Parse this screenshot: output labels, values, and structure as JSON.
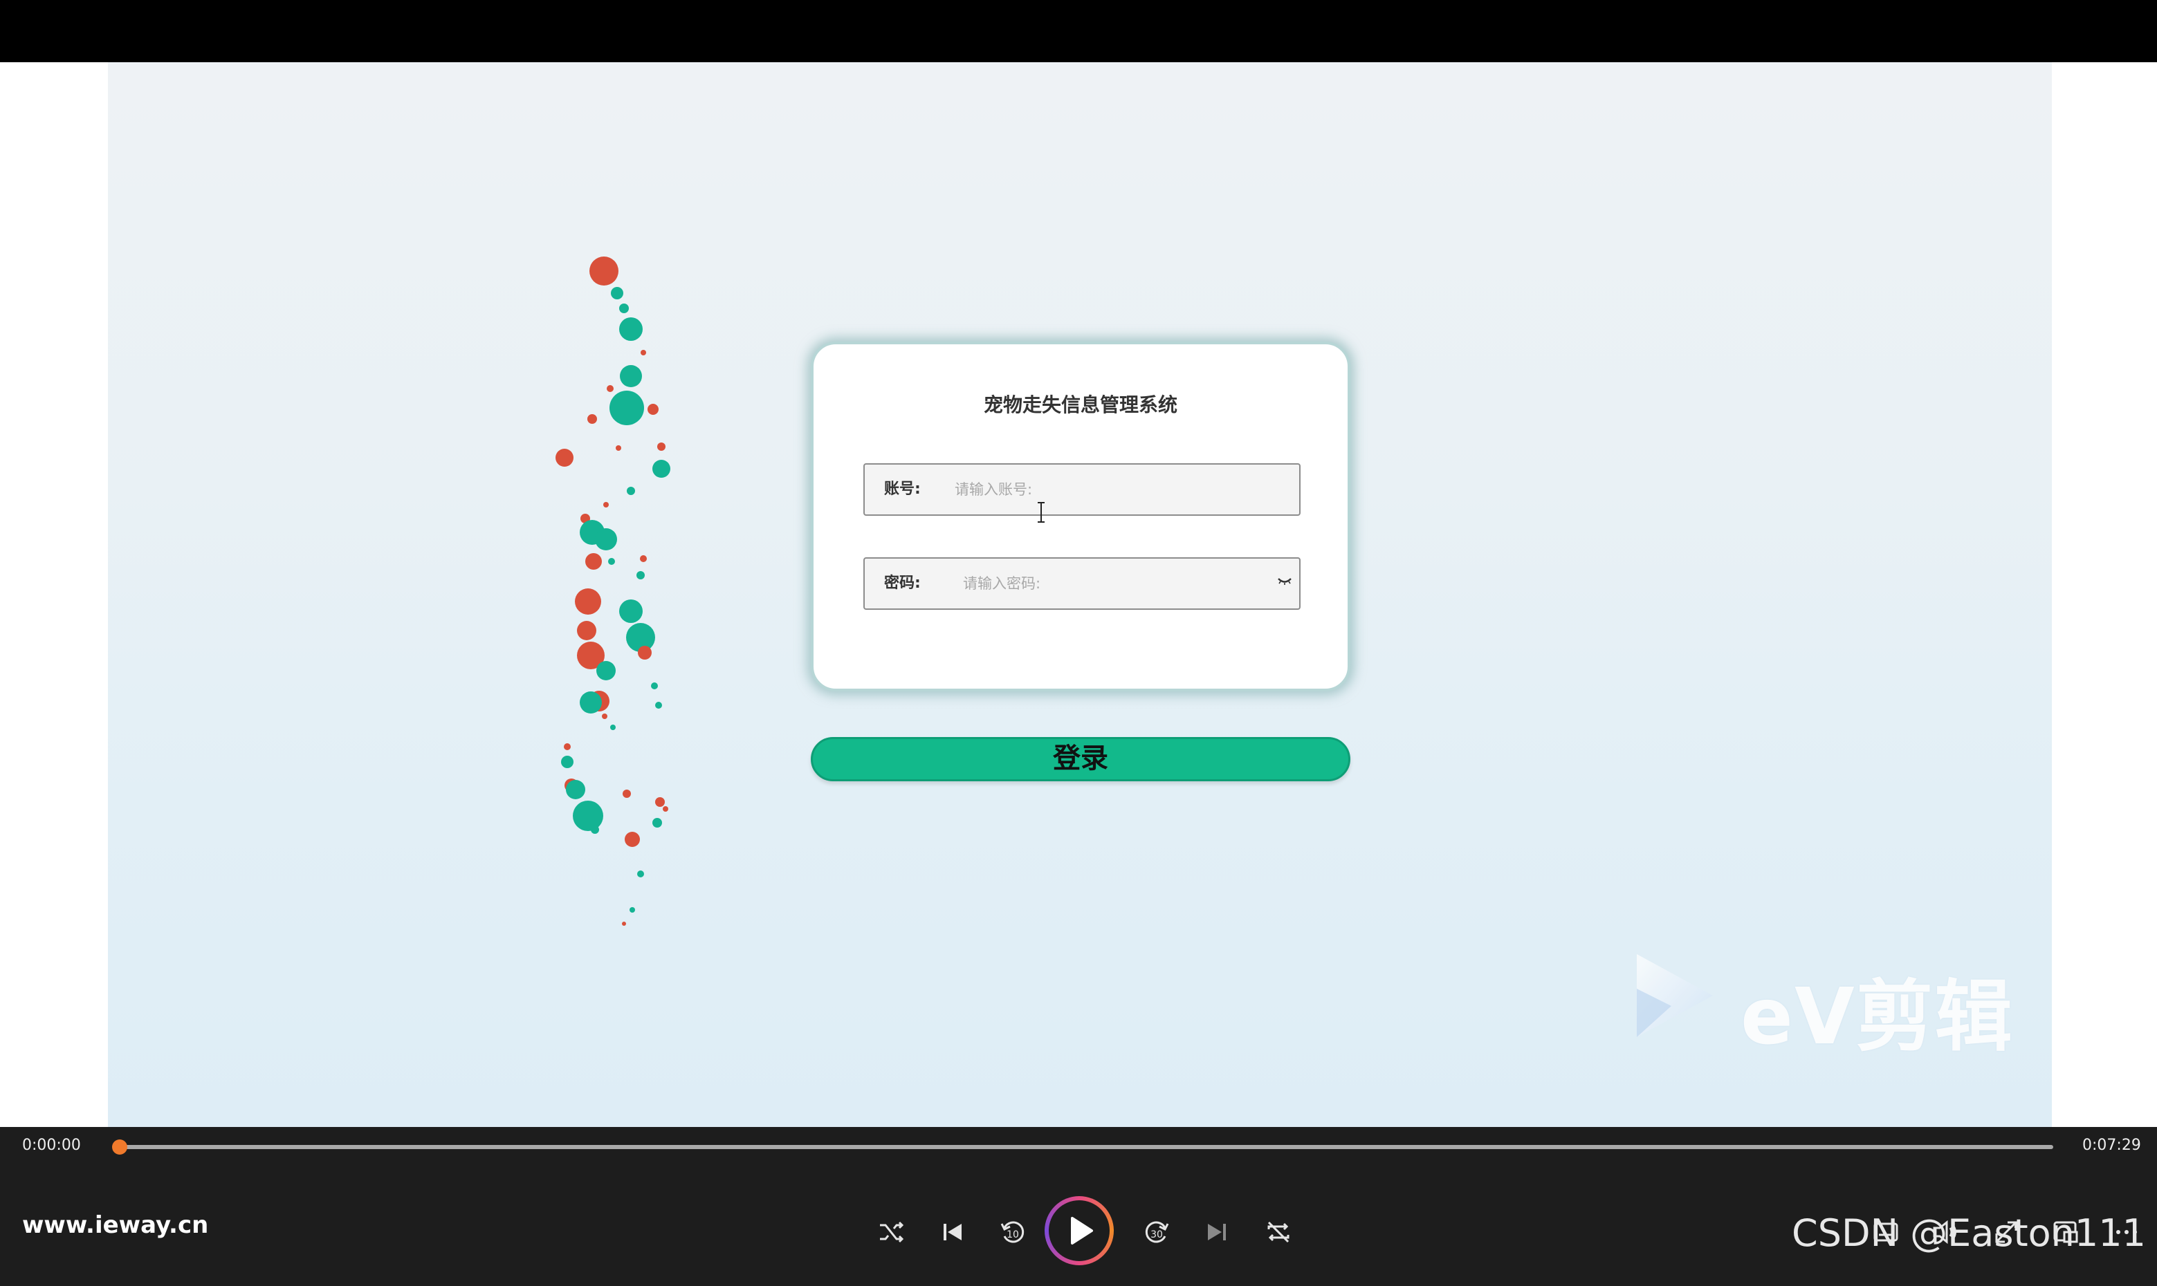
{
  "login": {
    "title": "宠物走失信息管理系统",
    "account_label": "账号:",
    "account_placeholder": "请输入账号:",
    "password_label": "密码:",
    "password_placeholder": "请输入密码:",
    "login_button": "登录"
  },
  "watermark": {
    "text": "eV剪辑"
  },
  "player": {
    "current_time": "0:00:00",
    "total_time": "0:07:29",
    "progress": 0.0,
    "brand": "www.ieway.cn",
    "csdn_watermark": "CSDN @Easton111"
  },
  "colors": {
    "dot_red": "#d9503a",
    "dot_teal": "#14b393",
    "button_green": "#12b98b",
    "progress_thumb": "#f07a2c"
  },
  "icons": [
    "shuffle-icon",
    "previous-icon",
    "rewind-10-icon",
    "play-icon",
    "forward-30-icon",
    "next-icon",
    "repeat-icon",
    "subtitles-icon",
    "volume-icon",
    "fullscreen-icon",
    "mini-player-icon",
    "more-icon",
    "eye-closed-icon",
    "text-cursor-icon"
  ]
}
